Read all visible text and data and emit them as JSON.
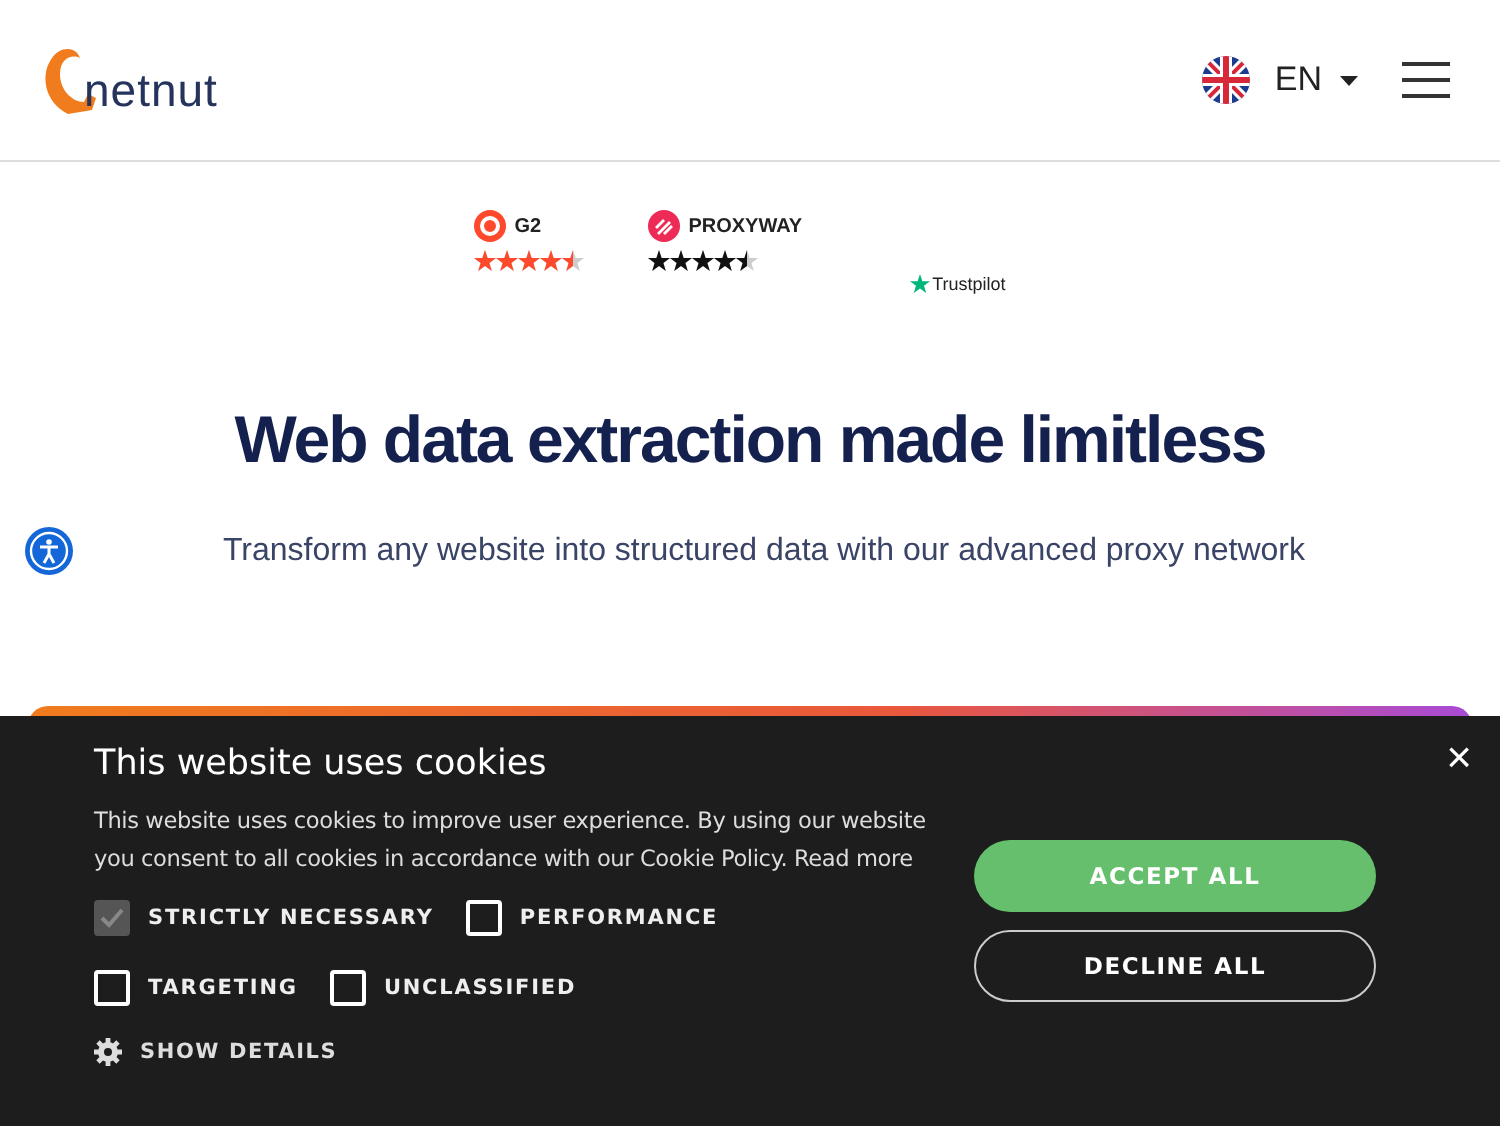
{
  "header": {
    "logo": "netnut",
    "language": "EN"
  },
  "ratings": [
    {
      "kind": "g2",
      "name": "G2",
      "stars": 4.5
    },
    {
      "kind": "proxyway",
      "name": "PROXYWAY",
      "stars": 4.5
    },
    {
      "kind": "trustpilot",
      "name": "Trustpilot"
    }
  ],
  "hero": {
    "title": "Web data extraction made limitless",
    "subtitle": "Transform any website into structured data with our advanced proxy network"
  },
  "cookie_banner": {
    "title": "This website uses cookies",
    "text": "This website uses cookies to improve user experience. By using our website you consent to all cookies in accordance with our Cookie Policy.",
    "link": "Read more",
    "options": [
      {
        "label": "STRICTLY NECESSARY",
        "checked": true,
        "disabled": true
      },
      {
        "label": "PERFORMANCE",
        "checked": false,
        "disabled": false
      },
      {
        "label": "TARGETING",
        "checked": false,
        "disabled": false
      },
      {
        "label": "UNCLASSIFIED",
        "checked": false,
        "disabled": false
      }
    ],
    "details": "SHOW DETAILS",
    "accept": "ACCEPT ALL",
    "decline": "DECLINE ALL",
    "close": "×"
  }
}
